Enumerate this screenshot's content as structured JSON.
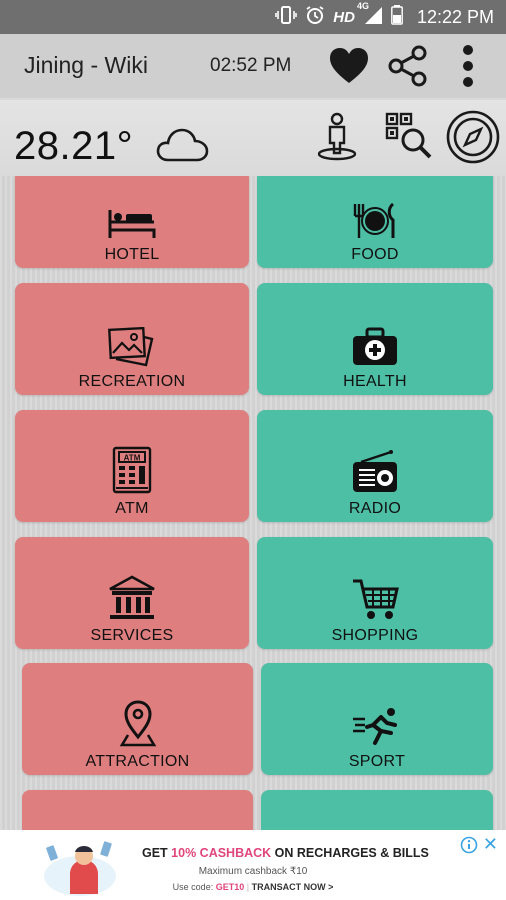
{
  "status_bar": {
    "hd": "HD",
    "network": "4G",
    "time": "12:22 PM"
  },
  "app_bar": {
    "title": "Jining - Wiki",
    "clock": "02:52 PM",
    "icons": [
      "heart-icon",
      "share-icon",
      "overflow-menu-icon"
    ]
  },
  "weather": {
    "temperature": "28.21°",
    "condition_icon": "cloud-icon",
    "actions": [
      "street-view-icon",
      "qr-search-icon",
      "compass-icon"
    ]
  },
  "tiles": [
    {
      "label": "HOTEL",
      "icon": "bed-icon",
      "color": "#df7e7f"
    },
    {
      "label": "FOOD",
      "icon": "fork-knife-icon",
      "color": "#4dbfa5"
    },
    {
      "label": "RECREATION",
      "icon": "pictures-icon",
      "color": "#df7e7f"
    },
    {
      "label": "HEALTH",
      "icon": "medkit-icon",
      "color": "#4dbfa5"
    },
    {
      "label": "ATM",
      "icon": "atm-icon",
      "color": "#df7e7f"
    },
    {
      "label": "RADIO",
      "icon": "radio-icon",
      "color": "#4dbfa5"
    },
    {
      "label": "SERVICES",
      "icon": "bank-icon",
      "color": "#df7e7f"
    },
    {
      "label": "SHOPPING",
      "icon": "cart-icon",
      "color": "#4dbfa5"
    },
    {
      "label": "ATTRACTION",
      "icon": "map-pin-icon",
      "color": "#df7e7f"
    },
    {
      "label": "SPORT",
      "icon": "runner-icon",
      "color": "#4dbfa5"
    }
  ],
  "ad": {
    "headline_pre": "GET ",
    "headline_highlight": "10% CASHBACK",
    "headline_post": " ON RECHARGES & BILLS",
    "subline": "Maximum cashback ₹10",
    "code_prefix": "Use code: ",
    "code": "GET10",
    "cta": "TRANSACT NOW >"
  }
}
